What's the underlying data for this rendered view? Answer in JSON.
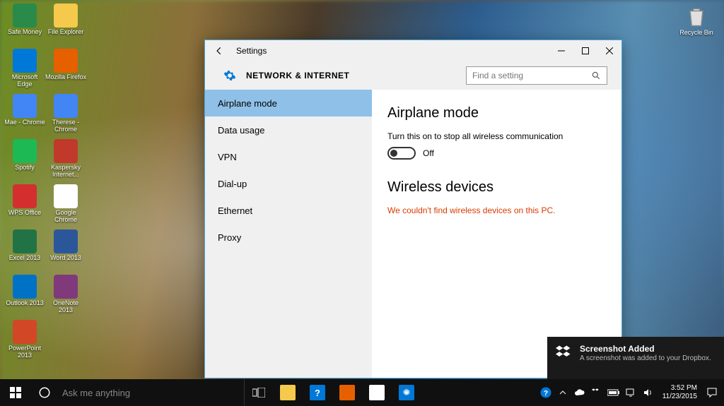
{
  "desktop_icons": [
    {
      "label": "Safe Money",
      "bg": "#2a8a4a"
    },
    {
      "label": "File Explorer",
      "bg": "#f5c94b"
    },
    {
      "label": "Microsoft Edge",
      "bg": "#0078d7"
    },
    {
      "label": "Mozilla Firefox",
      "bg": "#e66000"
    },
    {
      "label": "Mae - Chrome",
      "bg": "#4285f4"
    },
    {
      "label": "Therese - Chrome",
      "bg": "#4285f4"
    },
    {
      "label": "Spotify",
      "bg": "#1db954"
    },
    {
      "label": "Kaspersky Internet...",
      "bg": "#c0392b"
    },
    {
      "label": "WPS Office",
      "bg": "#d32f2f"
    },
    {
      "label": "Google Chrome",
      "bg": "#ffffff"
    },
    {
      "label": "Excel 2013",
      "bg": "#217346"
    },
    {
      "label": "Word 2013",
      "bg": "#2b579a"
    },
    {
      "label": "Outlook 2013",
      "bg": "#0072c6"
    },
    {
      "label": "OneNote 2013",
      "bg": "#80397b"
    },
    {
      "label": "PowerPoint 2013",
      "bg": "#d24726"
    }
  ],
  "recycle_label": "Recycle Bin",
  "settings": {
    "window_title": "Settings",
    "header_title": "NETWORK & INTERNET",
    "search_placeholder": "Find a setting",
    "nav": [
      {
        "label": "Airplane mode",
        "selected": true
      },
      {
        "label": "Data usage",
        "selected": false
      },
      {
        "label": "VPN",
        "selected": false
      },
      {
        "label": "Dial-up",
        "selected": false
      },
      {
        "label": "Ethernet",
        "selected": false
      },
      {
        "label": "Proxy",
        "selected": false
      }
    ],
    "content": {
      "title": "Airplane mode",
      "description": "Turn this on to stop all wireless communication",
      "toggle_state": "Off",
      "section2_title": "Wireless devices",
      "error_text": "We couldn't find wireless devices on this PC."
    }
  },
  "taskbar": {
    "cortana_placeholder": "Ask me anything",
    "apps": [
      {
        "name": "file-explorer",
        "bg": "#f5c94b"
      },
      {
        "name": "help",
        "bg": "#0078d7"
      },
      {
        "name": "firefox",
        "bg": "#e66000"
      },
      {
        "name": "chrome",
        "bg": "#ffffff"
      },
      {
        "name": "settings",
        "bg": "#0078d7"
      }
    ],
    "time": "3:52 PM",
    "date": "11/23/2015"
  },
  "notification": {
    "title": "Screenshot Added",
    "body": "A screenshot was added to your Dropbox."
  }
}
